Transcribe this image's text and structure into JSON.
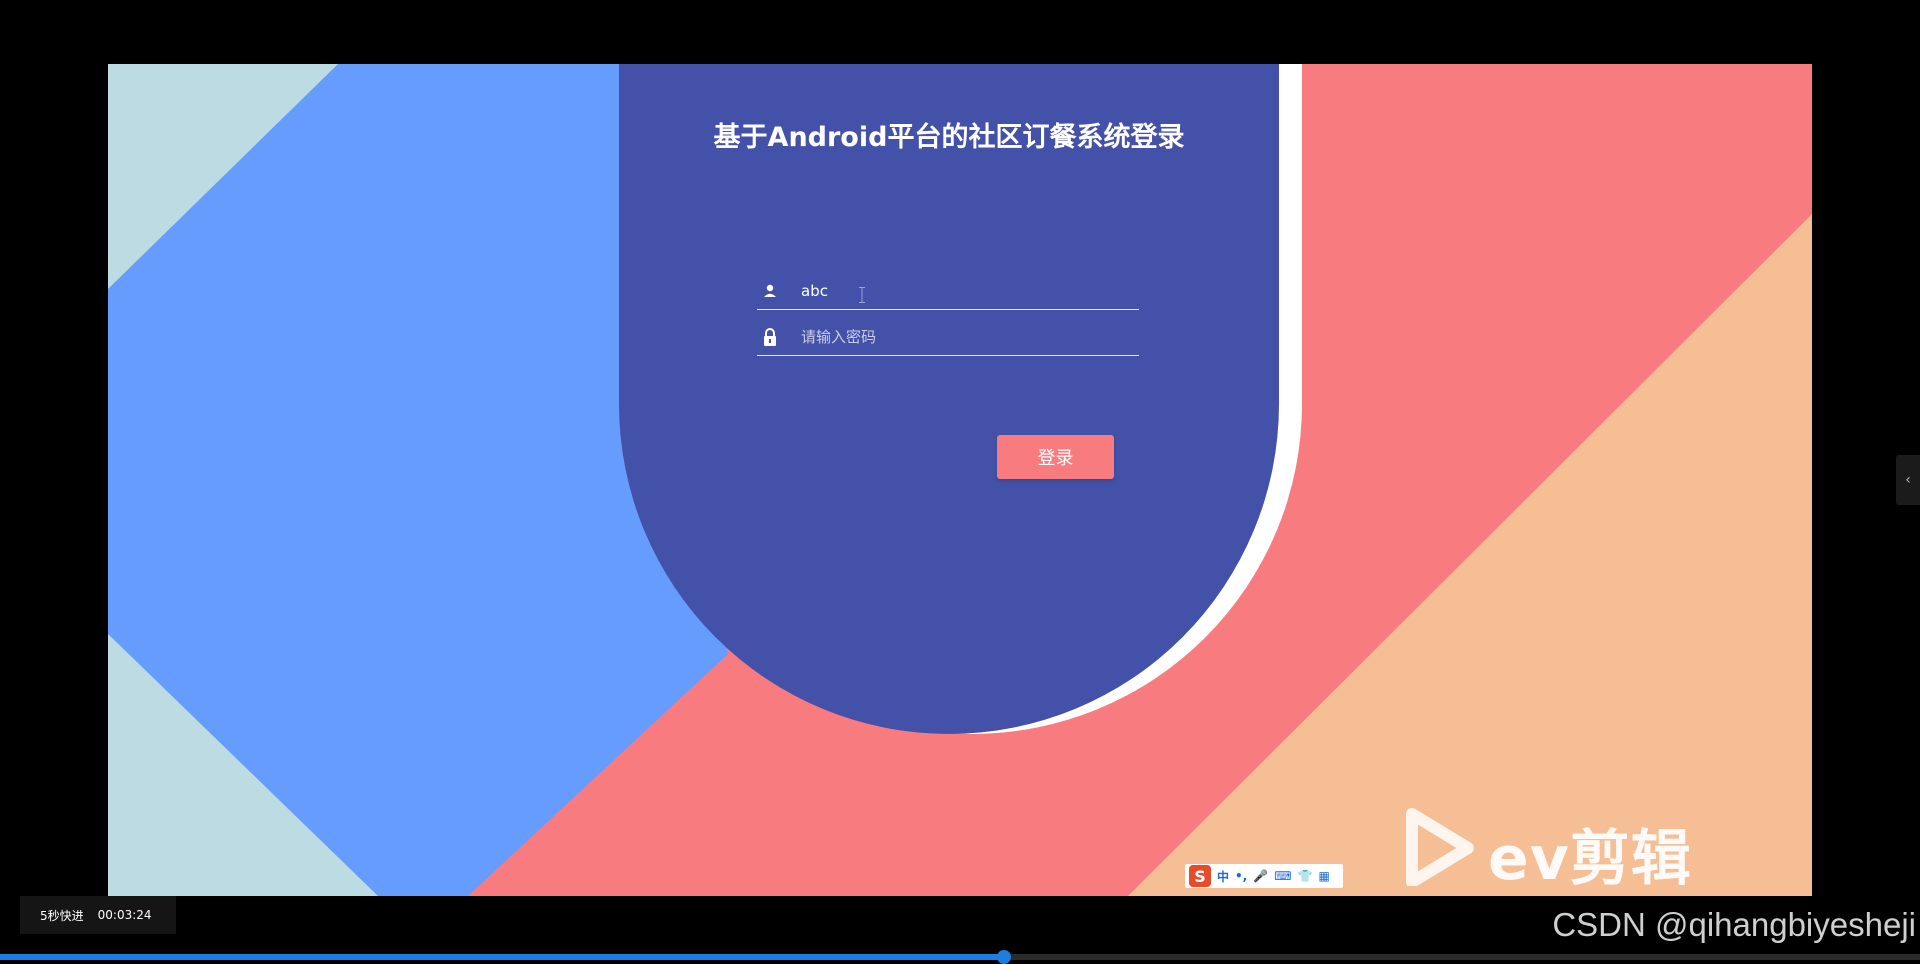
{
  "login": {
    "title": "基于Android平台的社区订餐系统登录",
    "username_value": "abc",
    "password_placeholder": "请输入密码",
    "login_button": "登录"
  },
  "ime": {
    "logo": "S",
    "items": [
      "中",
      "•,",
      "🎤",
      "⌨",
      "👕",
      "▦"
    ]
  },
  "watermark": {
    "text": "ev剪辑"
  },
  "player": {
    "speed_label": "5秒快进",
    "time": "00:03:24",
    "progress": 0.523
  },
  "overlay": {
    "csdn": "CSDN @qihangbiyesheji"
  },
  "colors": {
    "card": "#4351a9",
    "button": "#f87c7f",
    "bg_blue": "#669cfd",
    "bg_pink": "#f87c7f",
    "bg_peach": "#f6be95",
    "bg_light": "#bcdbe3",
    "progress": "#1a7fe0"
  },
  "icons": {
    "user": "user-icon",
    "lock": "lock-icon",
    "play": "play-logo-icon",
    "collapse": "chevron-left-icon"
  }
}
